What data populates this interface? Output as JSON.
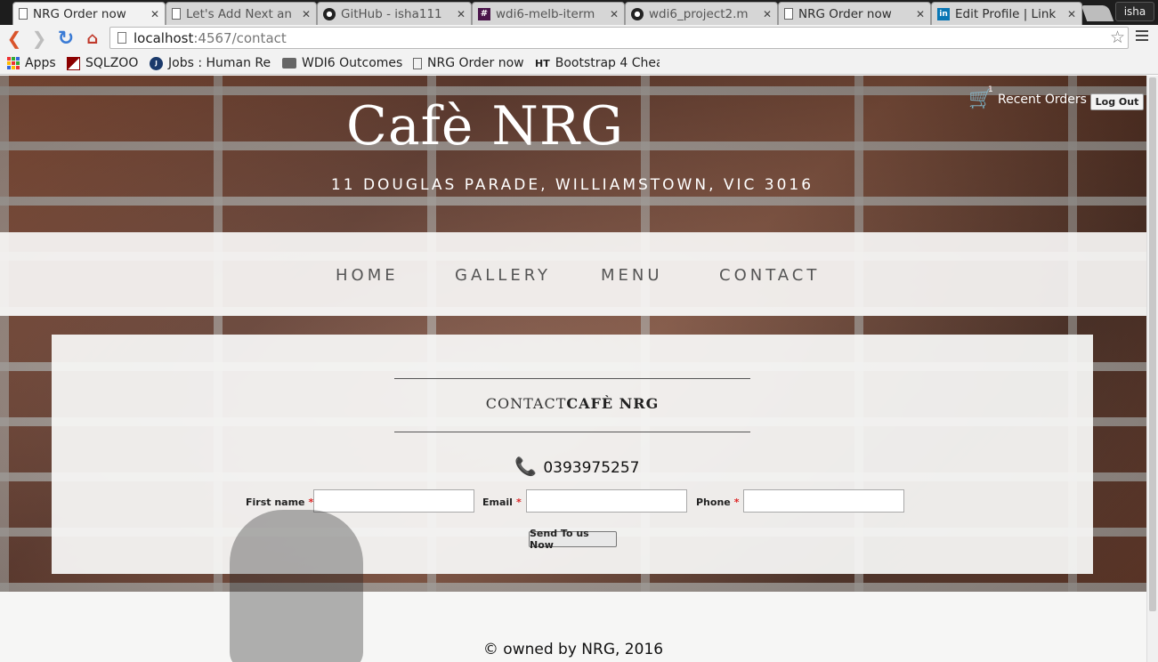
{
  "browser": {
    "tabs": [
      {
        "title": "NRG Order now",
        "icon": "doc-icon",
        "active": true,
        "close": "✕"
      },
      {
        "title": "Let's Add Next an",
        "icon": "doc-icon",
        "active": false,
        "close": "✕"
      },
      {
        "title": "GitHub - isha111",
        "icon": "github-icon",
        "active": false,
        "close": "✕"
      },
      {
        "title": "wdi6-melb-iterm",
        "icon": "hash-icon",
        "active": false,
        "close": "✕"
      },
      {
        "title": "wdi6_project2.m",
        "icon": "github-icon",
        "active": false,
        "close": "✕"
      },
      {
        "title": "NRG Order now",
        "icon": "doc-icon",
        "active": false,
        "close": "✕"
      },
      {
        "title": "Edit Profile | Link",
        "icon": "linkedin-icon",
        "active": false,
        "close": "✕"
      }
    ],
    "user": "isha",
    "url_host": "localhost",
    "url_rest": ":4567/contact",
    "bookmarks": [
      {
        "label": "Apps",
        "icon": "apps-grid-icon"
      },
      {
        "label": "SQLZOO",
        "icon": "sqlzoo-icon"
      },
      {
        "label": "Jobs : Human Re",
        "icon": "jobs-icon"
      },
      {
        "label": "WDI6 Outcomes",
        "icon": "folder-icon"
      },
      {
        "label": "NRG Order now",
        "icon": "doc-icon"
      },
      {
        "label": "Bootstrap 4 Chea",
        "icon": "ht-icon"
      }
    ]
  },
  "site": {
    "cart_count": "1",
    "recent_orders": "Recent Orders",
    "logout": "Log Out",
    "brand": "Cafè NRG",
    "address": "11 DOUGLAS PARADE, WILLIAMSTOWN, VIC 3016",
    "nav": [
      "HOME",
      "GALLERY",
      "MENU",
      "CONTACT"
    ]
  },
  "contact": {
    "heading_light": "CONTACT",
    "heading_bold": "CAFÈ NRG",
    "phone": "0393975257",
    "fields": [
      {
        "label": "First name",
        "required": "*",
        "value": ""
      },
      {
        "label": "Email",
        "required": "*",
        "value": ""
      },
      {
        "label": "Phone",
        "required": "*",
        "value": ""
      }
    ],
    "submit": "Send To us Now"
  },
  "footer": {
    "text": "© owned by NRG, 2016"
  }
}
